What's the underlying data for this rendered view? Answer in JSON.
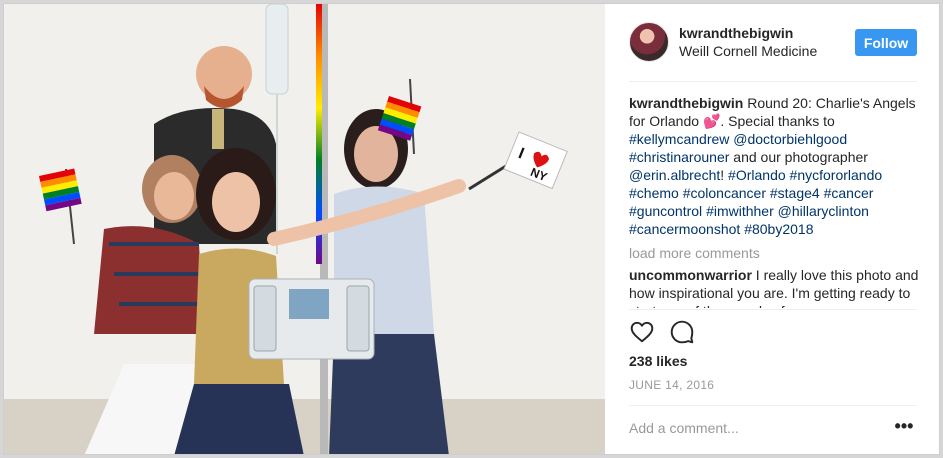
{
  "post": {
    "photo": {
      "description_icon": "photo-image",
      "flag_note": "Orlando support"
    },
    "header": {
      "username": "kwrandthebigwin",
      "location": "Weill Cornell Medicine",
      "follow_label": "Follow"
    },
    "caption": {
      "username": "kwrandthebigwin",
      "segments": [
        {
          "type": "text",
          "value": " Round 20: Charlie's Angels for Orlando "
        },
        {
          "type": "emoji",
          "value": "💕"
        },
        {
          "type": "text",
          "value": ". Special thanks to "
        },
        {
          "type": "tag",
          "value": "#kellymcandrew"
        },
        {
          "type": "text",
          "value": " "
        },
        {
          "type": "tag",
          "value": "@doctorbiehlgood"
        },
        {
          "type": "text",
          "value": " "
        },
        {
          "type": "tag",
          "value": "#christinarouner"
        },
        {
          "type": "text",
          "value": " and our photographer "
        },
        {
          "type": "tag",
          "value": "@erin.albrecht"
        },
        {
          "type": "text",
          "value": "! "
        },
        {
          "type": "tag",
          "value": "#Orlando"
        },
        {
          "type": "text",
          "value": " "
        },
        {
          "type": "tag",
          "value": "#nycfororlando"
        },
        {
          "type": "text",
          "value": " "
        },
        {
          "type": "tag",
          "value": "#chemo"
        },
        {
          "type": "text",
          "value": " "
        },
        {
          "type": "tag",
          "value": "#coloncancer"
        },
        {
          "type": "text",
          "value": " "
        },
        {
          "type": "tag",
          "value": "#stage4"
        },
        {
          "type": "text",
          "value": " "
        },
        {
          "type": "tag",
          "value": "#cancer"
        },
        {
          "type": "text",
          "value": " "
        },
        {
          "type": "tag",
          "value": "#guncontrol"
        },
        {
          "type": "text",
          "value": " "
        },
        {
          "type": "tag",
          "value": "#imwithher"
        },
        {
          "type": "text",
          "value": " "
        },
        {
          "type": "tag",
          "value": "@hillaryclinton"
        },
        {
          "type": "text",
          "value": " "
        },
        {
          "type": "tag",
          "value": "#cancermoonshot"
        },
        {
          "type": "text",
          "value": " "
        },
        {
          "type": "tag",
          "value": "#80by2018"
        }
      ]
    },
    "load_more_label": "load more comments",
    "comment": {
      "username": "uncommonwarrior",
      "text": " I really love this photo and how inspirational you are. I'm getting ready to start one of the rounds of"
    },
    "actions": {
      "like_icon": "heart-icon",
      "comment_icon": "comment-icon"
    },
    "likes_label": "238 likes",
    "date_label": "JUNE 14, 2016",
    "add_comment_placeholder": "Add a comment...",
    "more_label": "•••"
  },
  "colors": {
    "follow_button": "#3897f0",
    "hashtag": "#003569",
    "muted": "#999999",
    "text": "#262626"
  }
}
